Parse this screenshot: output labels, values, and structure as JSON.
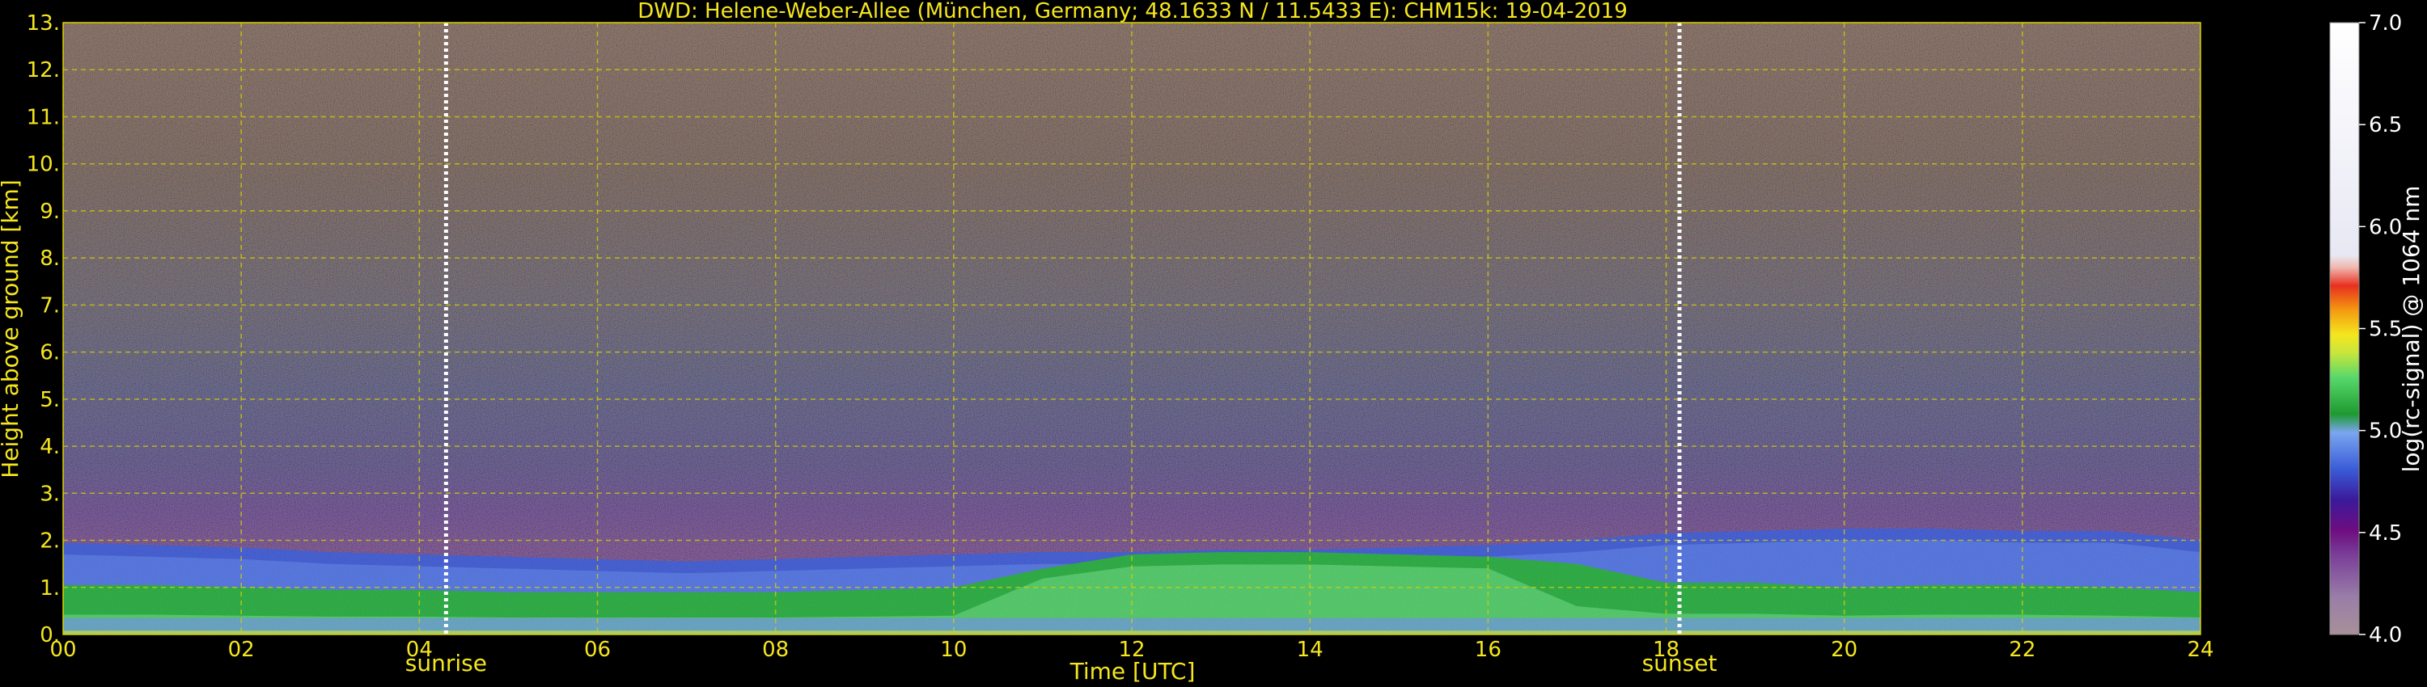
{
  "chart_data": {
    "type": "heatmap",
    "title": "DWD: Helene-Weber-Allee (München, Germany; 48.1633 N / 11.5433 E):    CHM15k: 19-04-2019",
    "xlabel": "Time [UTC]",
    "ylabel": "Height above ground [km]",
    "colorbar_label": "log(rc-signal) @ 1064 nm",
    "xlim": [
      0,
      24
    ],
    "ylim": [
      0,
      13
    ],
    "clim": [
      4.0,
      7.0
    ],
    "x_ticks": [
      "00",
      "02",
      "04",
      "06",
      "08",
      "10",
      "12",
      "14",
      "16",
      "18",
      "20",
      "22",
      "24"
    ],
    "y_ticks": [
      "0.",
      "1.",
      "2.",
      "3.",
      "4.",
      "5.",
      "6.",
      "7.",
      "8.",
      "9.",
      "10.",
      "11.",
      "12.",
      "13."
    ],
    "colorbar_ticks": [
      "4.0",
      "4.5",
      "5.0",
      "5.5",
      "6.0",
      "6.5",
      "7.0"
    ],
    "grid": true,
    "annotations": [
      {
        "label": "sunrise",
        "time": 4.3
      },
      {
        "label": "sunset",
        "time": 18.15
      }
    ],
    "colors": {
      "background": "#000000",
      "text_axes": "#f5e61e",
      "text_colorbar": "#ffffff",
      "grid": "#d8d000"
    },
    "layers": {
      "upper_boundary_km": [
        1.95,
        1.9,
        1.85,
        1.75,
        1.7,
        1.65,
        1.6,
        1.55,
        1.6,
        1.65,
        1.7,
        1.75,
        1.75,
        1.8,
        1.8,
        1.85,
        1.9,
        2.0,
        2.15,
        2.2,
        2.25,
        2.25,
        2.2,
        2.2,
        2.0
      ],
      "green_top_km": [
        1.05,
        1.05,
        1.0,
        0.95,
        0.95,
        0.9,
        0.9,
        0.9,
        0.9,
        0.95,
        1.0,
        1.4,
        1.7,
        1.75,
        1.75,
        1.7,
        1.65,
        1.5,
        1.1,
        1.1,
        1.0,
        1.05,
        1.05,
        1.0,
        0.9
      ]
    }
  }
}
